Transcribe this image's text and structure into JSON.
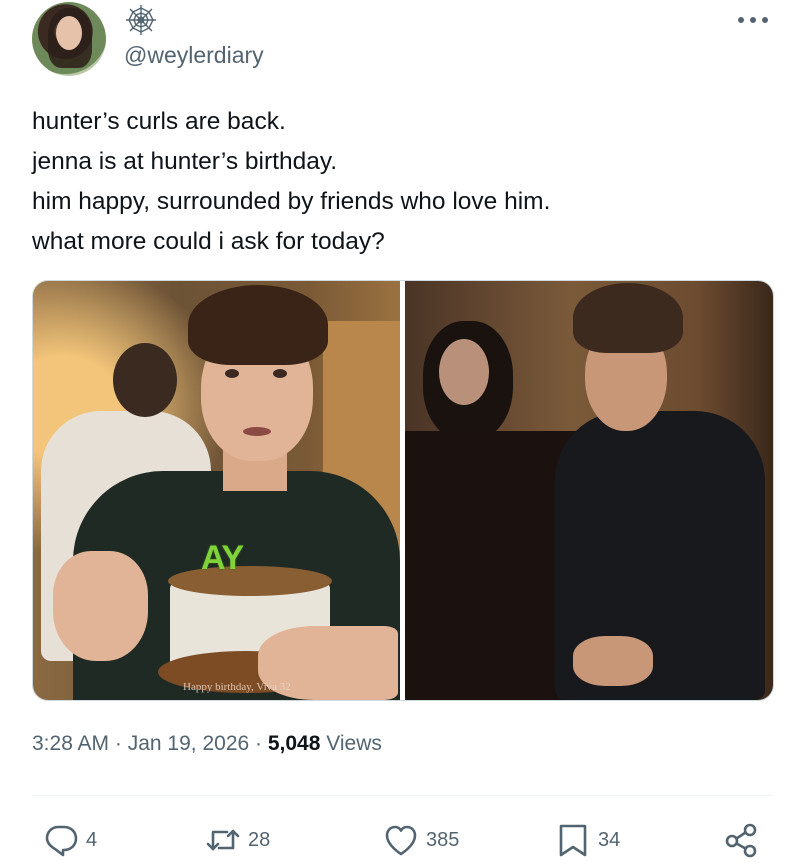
{
  "author": {
    "handle": "@weylerdiary",
    "avatar_icon": "profile-photo",
    "badge_icon": "spiderweb-icon"
  },
  "tweet": {
    "lines": [
      "hunter’s curls are back.",
      "jenna is at hunter’s birthday.",
      "him happy, surrounded by friends who love him.",
      "what more could i ask for today?"
    ]
  },
  "media": {
    "left_cake_text": "AY",
    "left_overlay_caption": "Happy birthday, Viva 32"
  },
  "meta": {
    "time": "3:28 AM",
    "separator": " · ",
    "date": "Jan 19, 2026",
    "views_count": "5,048",
    "views_label": " Views"
  },
  "actions": {
    "replies": "4",
    "reposts": "28",
    "likes": "385",
    "bookmarks": "34"
  },
  "colors": {
    "text": "#0f1419",
    "secondary": "#536471",
    "border": "#cfd9de"
  }
}
